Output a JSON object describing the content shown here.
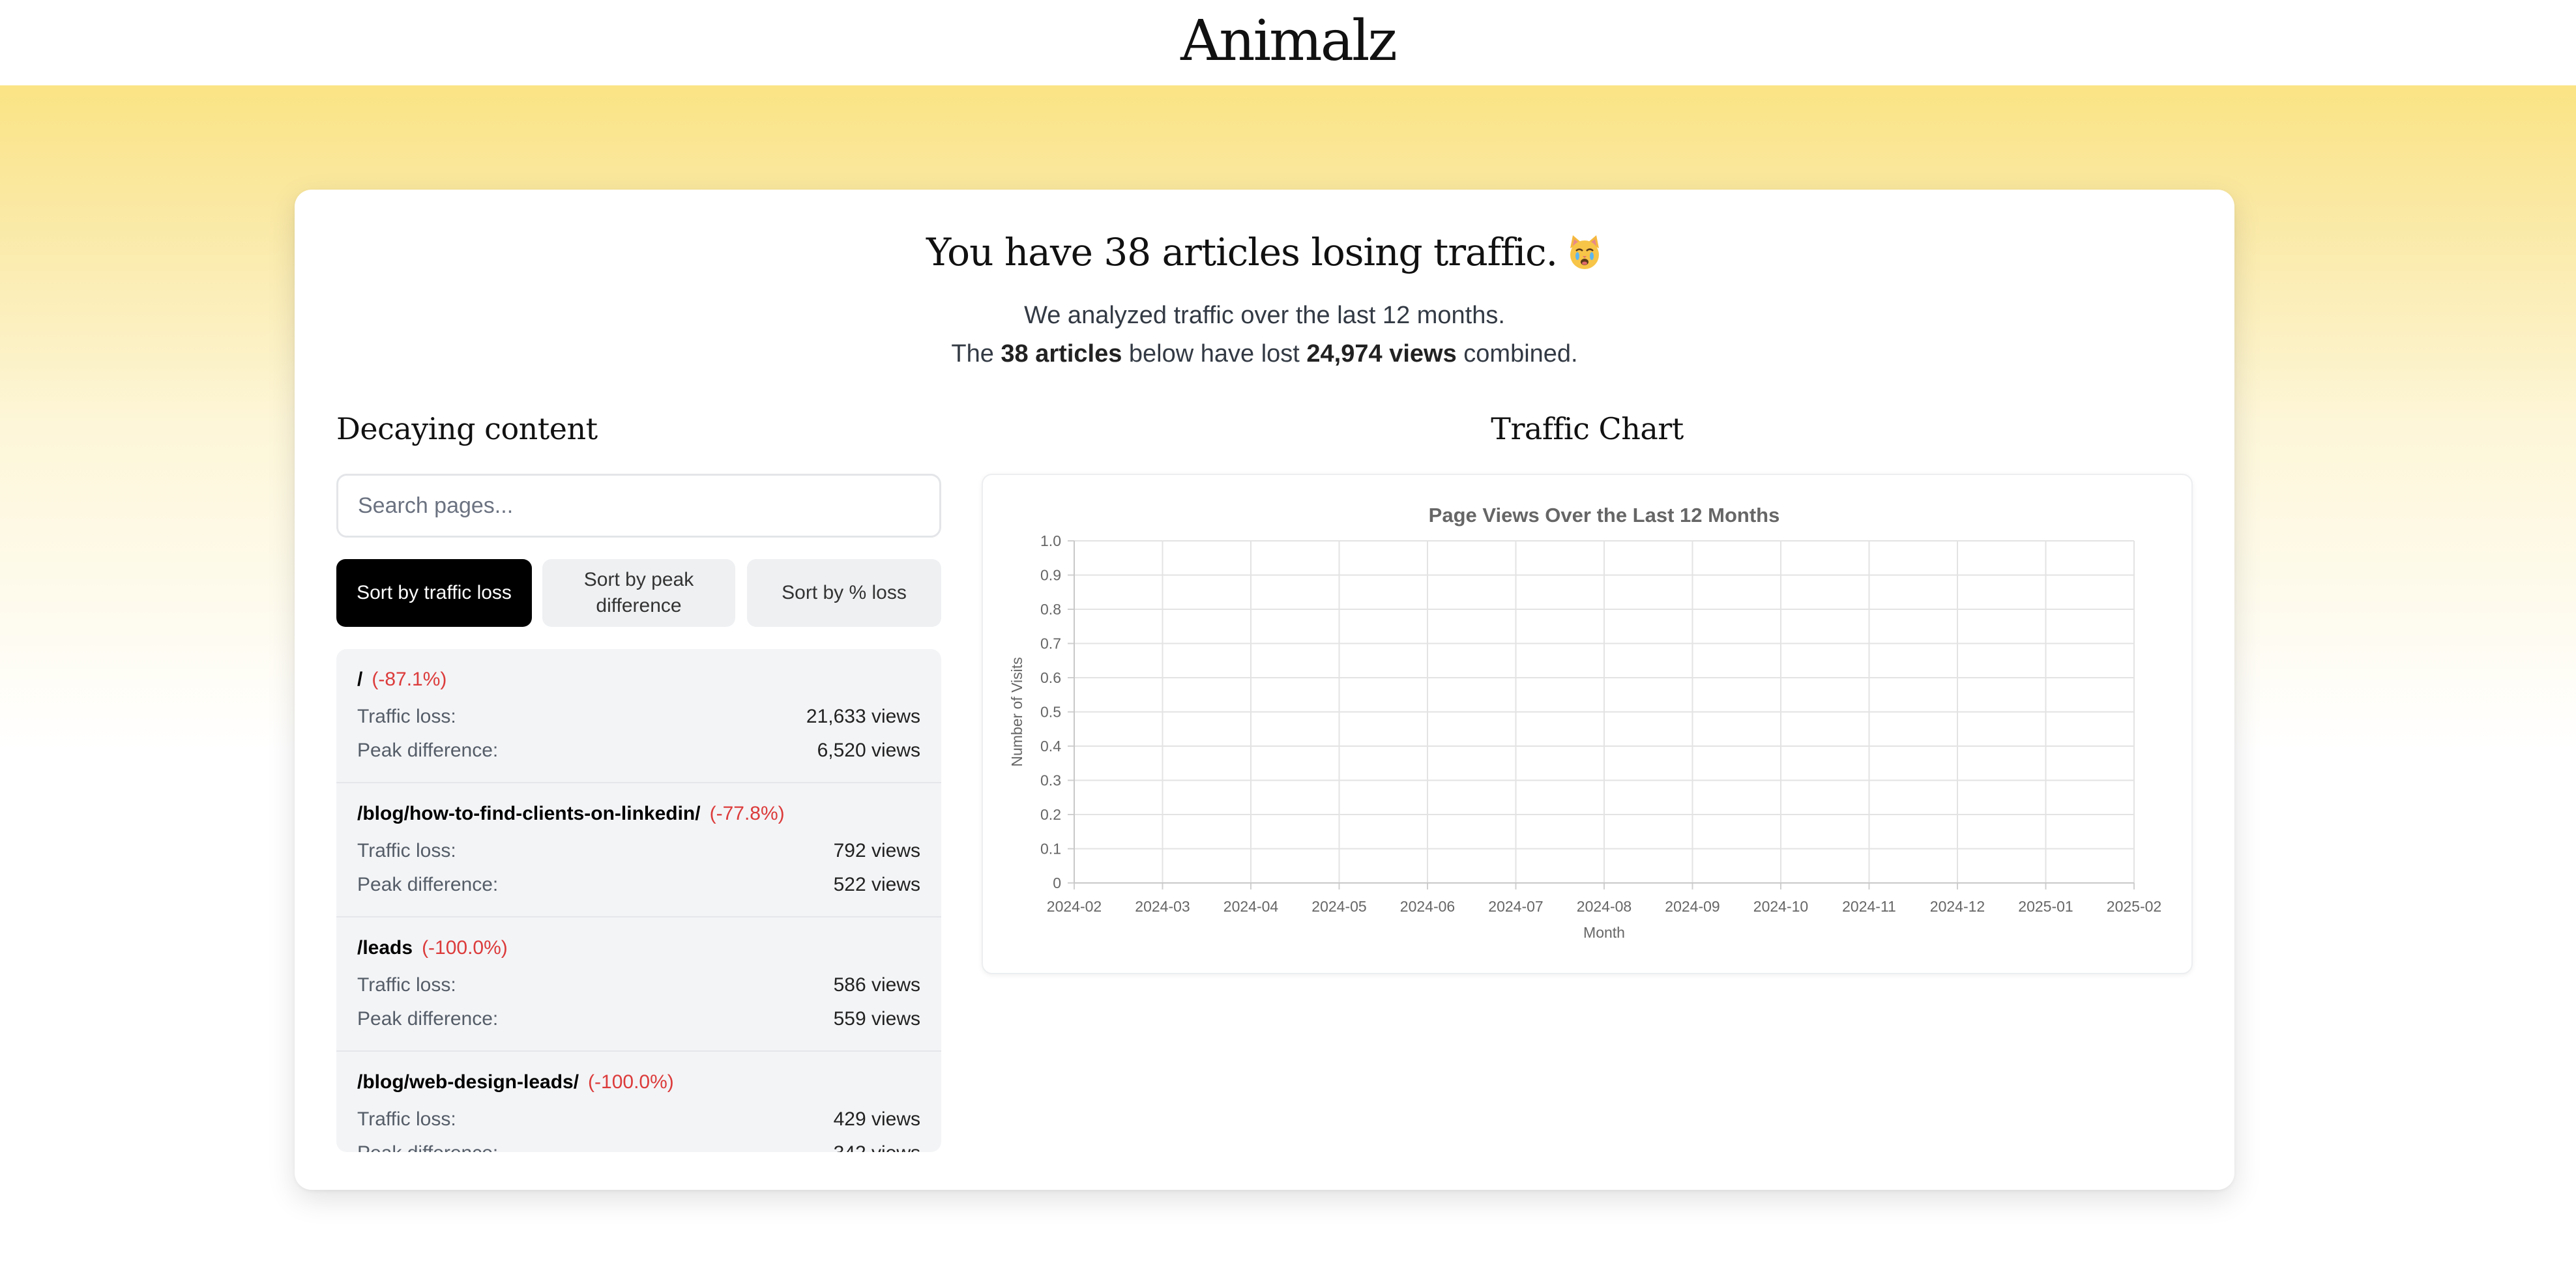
{
  "brand": "Animalz",
  "header": {
    "headline": "You have 38 articles losing traffic.",
    "emoji": "😿",
    "line1": "We analyzed traffic over the last 12 months.",
    "line2_prefix": "The ",
    "line2_count": "38 articles",
    "line2_mid": " below have lost ",
    "line2_views": "24,974 views",
    "line2_suffix": " combined."
  },
  "left": {
    "title": "Decaying content",
    "search_placeholder": "Search pages...",
    "sort_buttons": [
      "Sort by traffic loss",
      "Sort by peak difference",
      "Sort by % loss"
    ],
    "active_sort": 0,
    "traffic_label": "Traffic loss:",
    "peak_label": "Peak difference:",
    "items": [
      {
        "path": "/",
        "pct": "(-87.1%)",
        "traffic": "21,633 views",
        "peak": "6,520 views"
      },
      {
        "path": "/blog/how-to-find-clients-on-linkedin/",
        "pct": "(-77.8%)",
        "traffic": "792 views",
        "peak": "522 views"
      },
      {
        "path": "/leads",
        "pct": "(-100.0%)",
        "traffic": "586 views",
        "peak": "559 views"
      },
      {
        "path": "/blog/web-design-leads/",
        "pct": "(-100.0%)",
        "traffic": "429 views",
        "peak": "342 views"
      }
    ]
  },
  "right": {
    "title": "Traffic Chart"
  },
  "chart_data": {
    "type": "line",
    "title": "Page Views Over the Last 12 Months",
    "xlabel": "Month",
    "ylabel": "Number of Visits",
    "x": [
      "2024-02",
      "2024-03",
      "2024-04",
      "2024-05",
      "2024-06",
      "2024-07",
      "2024-08",
      "2024-09",
      "2024-10",
      "2024-11",
      "2024-12",
      "2025-01",
      "2025-02"
    ],
    "ylim": [
      0,
      1
    ],
    "yticks": [
      "0",
      "0.1",
      "0.2",
      "0.3",
      "0.4",
      "0.5",
      "0.6",
      "0.7",
      "0.8",
      "0.9",
      "1.0"
    ],
    "grid": true,
    "series": []
  },
  "colors": {
    "accent": "#000000",
    "negative": "#dc3b3b",
    "gradient_top": "#fae16f"
  }
}
